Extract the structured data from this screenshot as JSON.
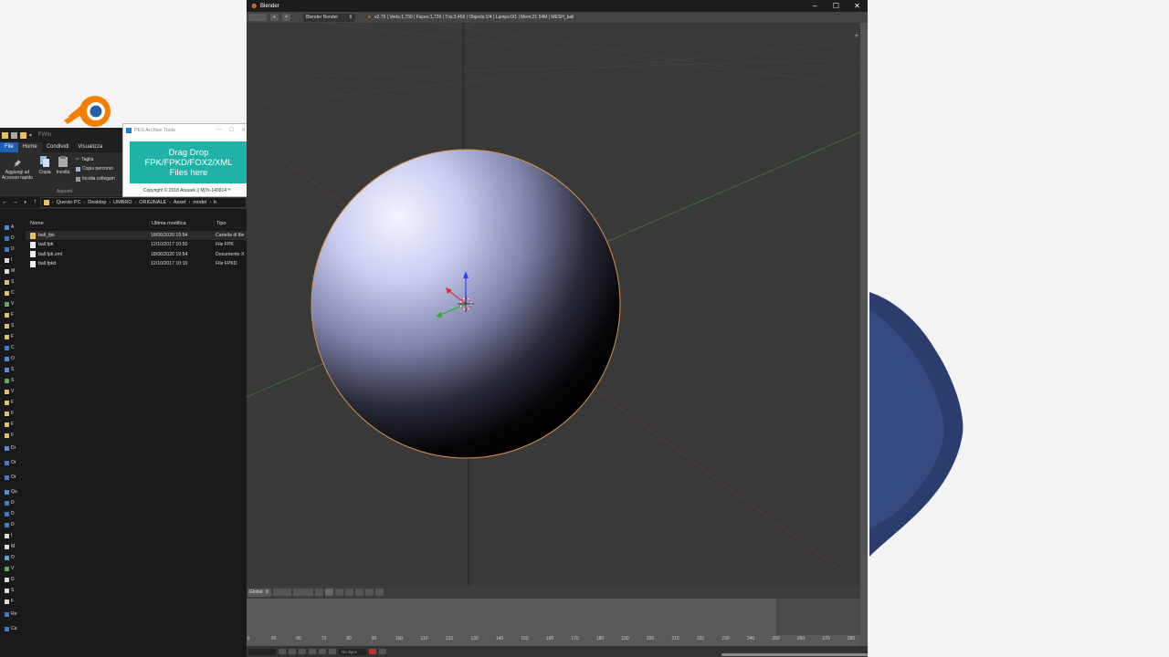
{
  "explorer": {
    "window_title": "FWin",
    "tabs": [
      "File",
      "Home",
      "Condividi",
      "Visualizza"
    ],
    "ribbon": {
      "pin_label": "Aggiungi ad Accesso rapido",
      "copy_label": "Copia",
      "paste_label": "Incolla",
      "cut_label": "Taglia",
      "copy_path_label": "Copia percorso",
      "paste_link_label": "Incolla collegam",
      "group_label": "Appunti"
    },
    "breadcrumb": [
      "Questo PC",
      "Desktop",
      "UMBRO",
      "ORIGINALE",
      "Asset",
      "model",
      "b"
    ],
    "columns": {
      "name": "Nome",
      "date": "Ultima modifica",
      "type": "Tipo"
    },
    "files": [
      {
        "name": "ball_fpk",
        "date": "18/06/2020 19:54",
        "type": "Cartella di file",
        "kind": "folder"
      },
      {
        "name": "ball.fpk",
        "date": "12/10/2017 10:50",
        "type": "File FPK",
        "kind": "file"
      },
      {
        "name": "ball.fpk.xml",
        "date": "18/06/2020 19:54",
        "type": "Documento X",
        "kind": "file"
      },
      {
        "name": "ball.fpkd",
        "date": "12/10/2017 10:10",
        "type": "File FPKD",
        "kind": "file"
      }
    ],
    "tree_labels": [
      "A",
      "D",
      "D",
      "I",
      "M",
      "S",
      "C",
      "V",
      "F",
      "S",
      "F",
      "C",
      "O",
      "S",
      "S",
      "V",
      "F",
      "F",
      "F",
      "F",
      "Dr",
      "Or",
      "Or",
      "Qu",
      "D",
      "D",
      "D",
      "I",
      "M",
      "O",
      "V",
      "D",
      "S",
      "F",
      "Re",
      "Ca"
    ]
  },
  "tool": {
    "title": "PES Archive Tools",
    "drop_line1": "Drag  Drop",
    "drop_line2": "FPK/FPKD/FOX2/XML",
    "drop_line3": "Files here",
    "copyright": "Copyright © 2018 Atvaark || MjTs-140914™"
  },
  "blender": {
    "window_title": "Blender",
    "render_engine": "Blender Render",
    "stats": "v2.79 | Verts:1,730 | Faces:1,726 | Tris:3,456 | Objects:1/4 | Lamps:0/1 | Mem:21.54M | MESH_ball",
    "transform_orientation": "Global",
    "timeline_ticks": [
      "0",
      "50",
      "60",
      "70",
      "80",
      "90",
      "100",
      "110",
      "120",
      "130",
      "140",
      "150",
      "160",
      "170",
      "180",
      "190",
      "200",
      "210",
      "220",
      "230",
      "240",
      "250",
      "260",
      "270",
      "280"
    ],
    "sync_label": "No Sync",
    "colors": {
      "viewport_bg": "#393939",
      "sphere_outline": "#d9904a",
      "axis_z": "#2244ff",
      "axis_x": "#e03030",
      "axis_y": "#28b428",
      "tool_accent": "#1fb2a6"
    }
  }
}
